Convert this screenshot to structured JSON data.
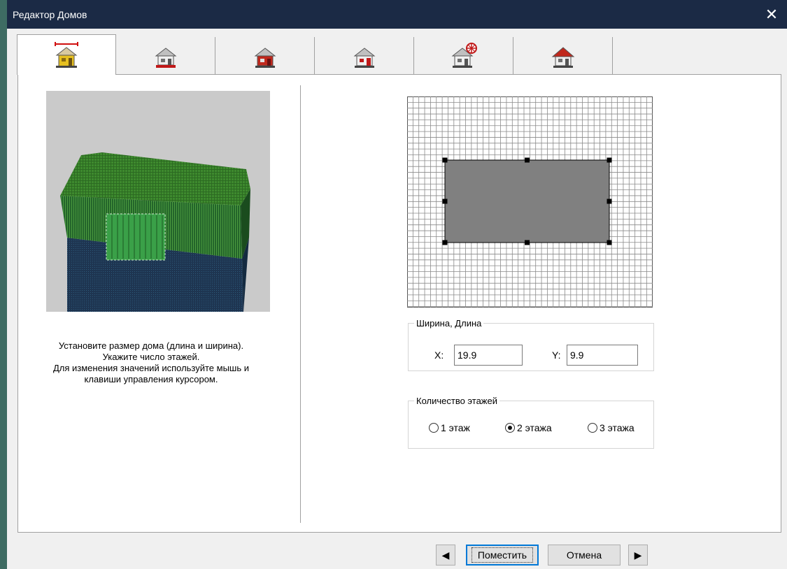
{
  "window": {
    "title": "Редактор Домов",
    "close_symbol": "✕"
  },
  "tabs": [
    {
      "icon": "house-size-icon",
      "active": true
    },
    {
      "icon": "house-foundation-icon",
      "active": false
    },
    {
      "icon": "house-walls-icon",
      "active": false
    },
    {
      "icon": "house-door-icon",
      "active": false
    },
    {
      "icon": "house-windows-icon",
      "active": false
    },
    {
      "icon": "house-roof-icon",
      "active": false
    }
  ],
  "instructions": {
    "line1": "Установите размер дома (длина и ширина).",
    "line2": "Укажите число этажей.",
    "line3": "Для изменения значений используйте мышь и",
    "line4": "клавиши управления курсором."
  },
  "dimensions": {
    "legend": "Ширина, Длина",
    "x_label": "X:",
    "x_value": "19.9",
    "y_label": "Y:",
    "y_value": "9.9"
  },
  "floors": {
    "legend": "Количество этажей",
    "options": [
      {
        "label": "1 этаж",
        "selected": false
      },
      {
        "label": "2 этажа",
        "selected": true
      },
      {
        "label": "3 этажа",
        "selected": false
      }
    ]
  },
  "footer": {
    "prev_symbol": "◀",
    "place_label": "Поместить",
    "cancel_label": "Отмена",
    "next_symbol": "▶"
  },
  "colors": {
    "titlebar": "#1b2a45",
    "roof_green": "#3e8a2e",
    "wall_green": "#1f5a24",
    "lower_wall": "#1e3551",
    "footprint": "#808080"
  }
}
